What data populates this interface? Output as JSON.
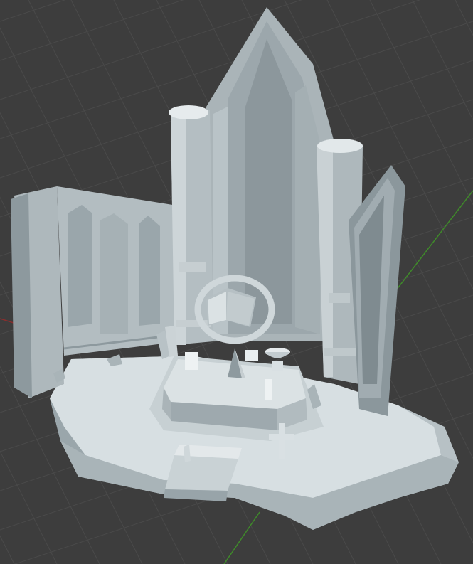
{
  "viewport": {
    "background": "#3d3d3d",
    "grid_color": "#4a4a4a",
    "axis_x_color": "#8a2e2e",
    "axis_y_color": "#3f8a2a"
  },
  "model": {
    "base_color": "#d4dcdf",
    "stone_color": "#b9c3c7",
    "stone_dark": "#8f9ba0",
    "stone_shadow": "#6f7b80"
  }
}
